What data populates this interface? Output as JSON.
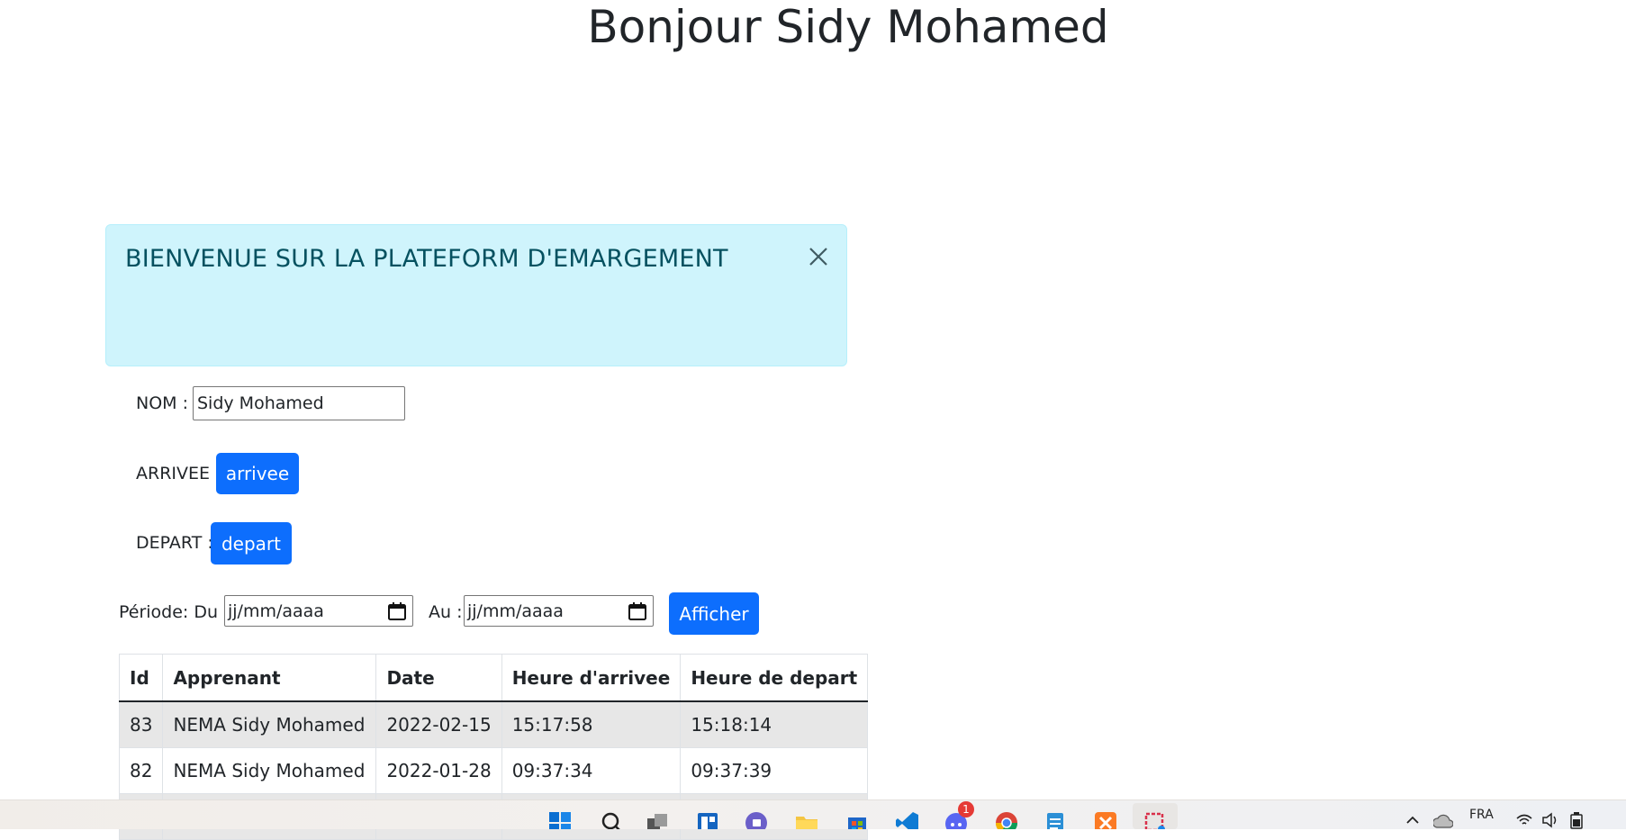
{
  "header": {
    "title": "Bonjour Sidy Mohamed"
  },
  "alert": {
    "message": "BIENVENUE SUR LA PLATEFORM D'EMARGEMENT"
  },
  "form": {
    "nom_label": "NOM :",
    "nom_value": "Sidy Mohamed",
    "arrivee_label": "ARRIVEE :",
    "arrivee_button": "arrivee",
    "depart_label": "DEPART :",
    "depart_button": "depart"
  },
  "filter": {
    "period_label": "Période: Du :",
    "from_value": "jj/mm/aaaa",
    "to_label": "Au :",
    "to_value": "jj/mm/aaaa",
    "submit_label": "Afficher"
  },
  "table": {
    "headers": [
      "Id",
      "Apprenant",
      "Date",
      "Heure d'arrivee",
      "Heure de depart"
    ],
    "rows": [
      [
        "83",
        "NEMA Sidy Mohamed",
        "2022-02-15",
        "15:17:58",
        "15:18:14"
      ],
      [
        "82",
        "NEMA Sidy Mohamed",
        "2022-01-28",
        "09:37:34",
        "09:37:39"
      ]
    ]
  },
  "taskbar": {
    "icons": [
      "windows-start-icon",
      "search-icon",
      "task-view-icon",
      "widgets-icon",
      "teams-chat-icon",
      "file-explorer-icon",
      "store-icon",
      "vscode-icon",
      "discord-icon",
      "chrome-icon",
      "notepad-icon",
      "xampp-icon",
      "snipping-tool-icon"
    ],
    "discord_badge": "1",
    "language": "FRA"
  },
  "colors": {
    "primary": "#0d6efd",
    "alert_bg": "#cff4fc",
    "alert_text": "#055160",
    "stripe": "#e7e7e7"
  }
}
